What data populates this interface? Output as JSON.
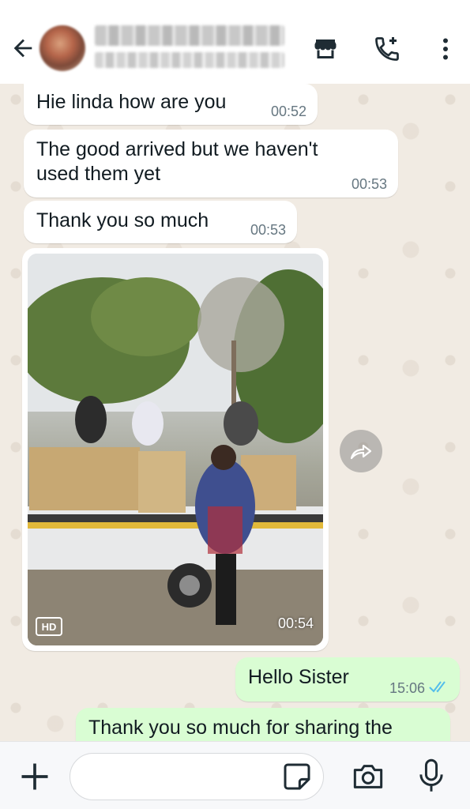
{
  "header": {
    "contact_name": "████ ██████ ███",
    "contact_status": "████████ · ██████",
    "icons": [
      "back-arrow-icon",
      "store-icon",
      "add-call-icon",
      "more-vert-icon"
    ]
  },
  "messages": [
    {
      "direction": "in",
      "text": "Hie linda how are you",
      "time": "00:52"
    },
    {
      "direction": "in",
      "text": "The good arrived but we haven't used them yet",
      "time": "00:53"
    },
    {
      "direction": "in",
      "text": "Thank you so much",
      "time": "00:53"
    },
    {
      "direction": "in",
      "type": "photo",
      "badge": "HD",
      "time": "00:54"
    },
    {
      "direction": "out",
      "text": "Hello Sister",
      "time": "15:06",
      "status": "read"
    },
    {
      "direction": "out",
      "text": "Thank you so much for sharing the",
      "time": ""
    }
  ],
  "input": {
    "placeholder": "",
    "icons": [
      "plus-icon",
      "sticker-icon",
      "camera-icon",
      "mic-icon"
    ]
  },
  "colors": {
    "outgoing_bubble": "#d9fdd3",
    "incoming_bubble": "#ffffff",
    "chat_background": "#f1ebe3",
    "read_ticks": "#53bdeb",
    "icon": "#1f2c34"
  }
}
